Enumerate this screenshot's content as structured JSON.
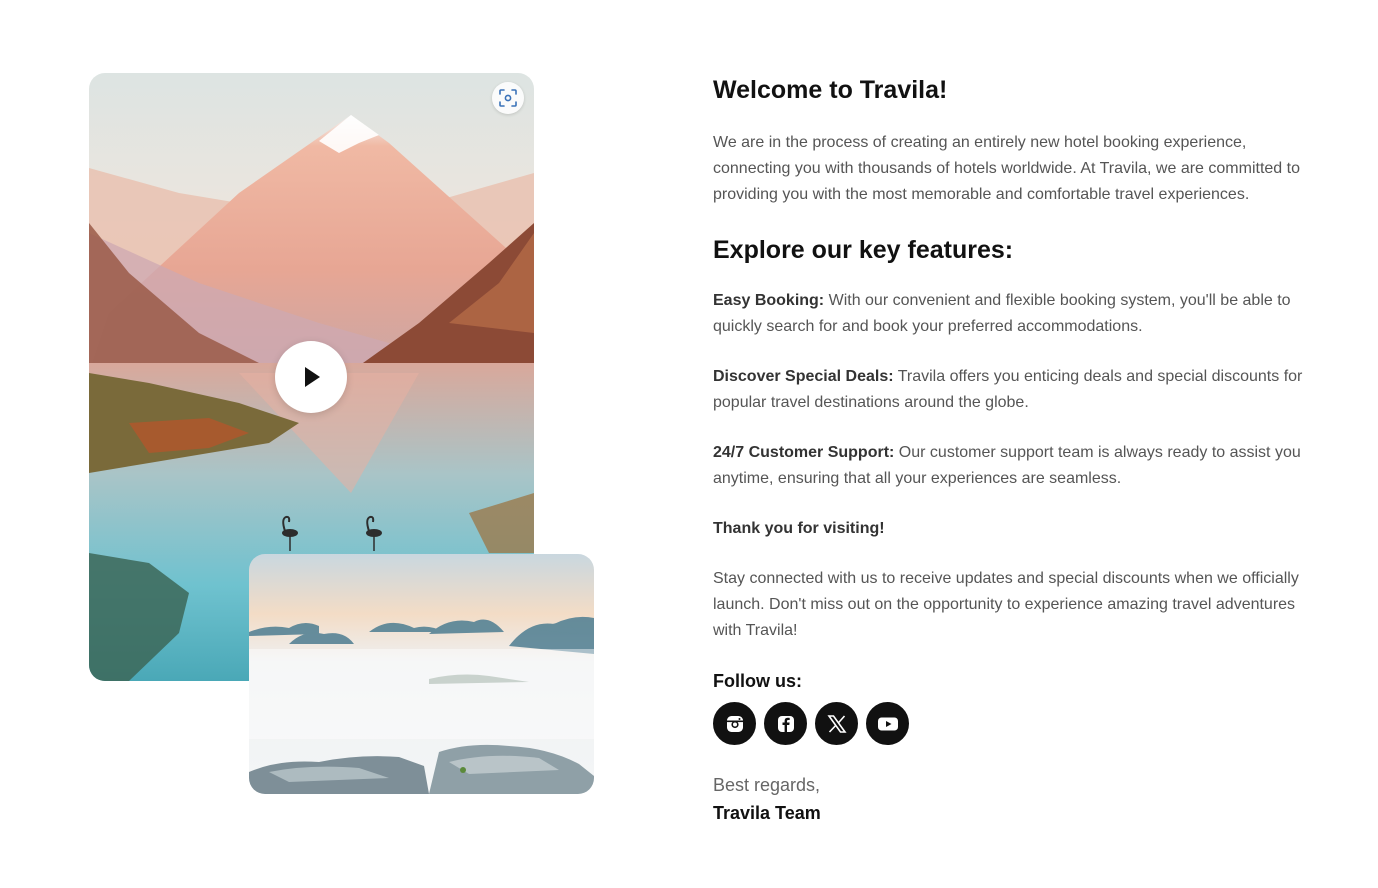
{
  "hero": {
    "title": "Welcome to Travila!",
    "intro": "We are in the process of creating an entirely new hotel booking experience, connecting you with thousands of hotels worldwide. At Travila, we are committed to providing you with the most memorable and comfortable travel experiences."
  },
  "features": {
    "heading": "Explore our key features:",
    "items": [
      {
        "label": "Easy Booking:",
        "text": " With our convenient and flexible booking system, you'll be able to quickly search for and book your preferred accommodations."
      },
      {
        "label": "Discover Special Deals:",
        "text": " Travila offers you enticing deals and special discounts for popular travel destinations around the globe."
      },
      {
        "label": "24/7 Customer Support:",
        "text": " Our customer support team is always ready to assist you anytime, ensuring that all your experiences are seamless."
      }
    ]
  },
  "thanks": "Thank you for visiting!",
  "closing": "Stay connected with us to receive updates and special discounts when we officially launch. Don't miss out on the opportunity to experience amazing travel adventures with Travila!",
  "follow": {
    "label": "Follow us:",
    "icons": [
      "instagram-icon",
      "facebook-icon",
      "x-icon",
      "youtube-icon"
    ]
  },
  "signoff": {
    "regards": "Best regards,",
    "team": "Travila Team"
  },
  "media": {
    "play_icon": "play-icon",
    "scan_icon": "scan-icon"
  }
}
